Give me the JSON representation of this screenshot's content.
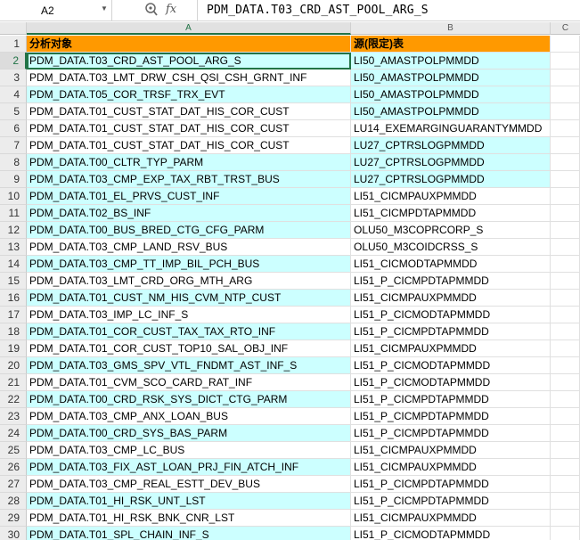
{
  "formula_bar": {
    "name_box": "A2",
    "fx_label": "fx",
    "content": "PDM_DATA.T03_CRD_AST_POOL_ARG_S"
  },
  "columns": [
    "A",
    "B",
    "C"
  ],
  "header_row": {
    "row": "1",
    "a": "分析对象",
    "b": "源(限定)表"
  },
  "rows": [
    {
      "n": "2",
      "a": "PDM_DATA.T03_CRD_AST_POOL_ARG_S",
      "b": "LI50_AMASTPOLPMMDD",
      "hl_a": true,
      "hl_b": true
    },
    {
      "n": "3",
      "a": "PDM_DATA.T03_LMT_DRW_CSH_QSI_CSH_GRNT_INF",
      "b": "LI50_AMASTPOLPMMDD",
      "hl_a": false,
      "hl_b": true
    },
    {
      "n": "4",
      "a": "PDM_DATA.T05_COR_TRSF_TRX_EVT",
      "b": "LI50_AMASTPOLPMMDD",
      "hl_a": true,
      "hl_b": true
    },
    {
      "n": "5",
      "a": "PDM_DATA.T01_CUST_STAT_DAT_HIS_COR_CUST",
      "b": "LI50_AMASTPOLPMMDD",
      "hl_a": false,
      "hl_b": true
    },
    {
      "n": "6",
      "a": "PDM_DATA.T01_CUST_STAT_DAT_HIS_COR_CUST",
      "b": "LU14_EXEMARGINGUARANTYMMDD",
      "hl_a": false,
      "hl_b": false
    },
    {
      "n": "7",
      "a": "PDM_DATA.T01_CUST_STAT_DAT_HIS_COR_CUST",
      "b": "LU27_CPTRSLOGPMMDD",
      "hl_a": false,
      "hl_b": true
    },
    {
      "n": "8",
      "a": "PDM_DATA.T00_CLTR_TYP_PARM",
      "b": "LU27_CPTRSLOGPMMDD",
      "hl_a": true,
      "hl_b": true
    },
    {
      "n": "9",
      "a": "PDM_DATA.T03_CMP_EXP_TAX_RBT_TRST_BUS",
      "b": "LU27_CPTRSLOGPMMDD",
      "hl_a": true,
      "hl_b": true
    },
    {
      "n": "10",
      "a": "PDM_DATA.T01_EL_PRVS_CUST_INF",
      "b": "LI51_CICMPAUXPMMDD",
      "hl_a": true,
      "hl_b": false
    },
    {
      "n": "11",
      "a": "PDM_DATA.T02_BS_INF",
      "b": "LI51_CICMPDTAPMMDD",
      "hl_a": true,
      "hl_b": false
    },
    {
      "n": "12",
      "a": "PDM_DATA.T00_BUS_BRED_CTG_CFG_PARM",
      "b": "OLU50_M3COPRCORP_S",
      "hl_a": true,
      "hl_b": false
    },
    {
      "n": "13",
      "a": "PDM_DATA.T03_CMP_LAND_RSV_BUS",
      "b": "OLU50_M3COIDCRSS_S",
      "hl_a": false,
      "hl_b": false
    },
    {
      "n": "14",
      "a": "PDM_DATA.T03_CMP_TT_IMP_BIL_PCH_BUS",
      "b": "LI51_CICMODTAPMMDD",
      "hl_a": true,
      "hl_b": false
    },
    {
      "n": "15",
      "a": "PDM_DATA.T03_LMT_CRD_ORG_MTH_ARG",
      "b": "LI51_P_CICMPDTAPMMDD",
      "hl_a": false,
      "hl_b": false
    },
    {
      "n": "16",
      "a": "PDM_DATA.T01_CUST_NM_HIS_CVM_NTP_CUST",
      "b": "LI51_CICMPAUXPMMDD",
      "hl_a": true,
      "hl_b": false
    },
    {
      "n": "17",
      "a": "PDM_DATA.T03_IMP_LC_INF_S",
      "b": "LI51_P_CICMODTAPMMDD",
      "hl_a": false,
      "hl_b": false
    },
    {
      "n": "18",
      "a": "PDM_DATA.T01_COR_CUST_TAX_TAX_RTO_INF",
      "b": "LI51_P_CICMPDTAPMMDD",
      "hl_a": true,
      "hl_b": false
    },
    {
      "n": "19",
      "a": "PDM_DATA.T01_COR_CUST_TOP10_SAL_OBJ_INF",
      "b": "LI51_CICMPAUXPMMDD",
      "hl_a": false,
      "hl_b": false
    },
    {
      "n": "20",
      "a": "PDM_DATA.T03_GMS_SPV_VTL_FNDMT_AST_INF_S",
      "b": "LI51_P_CICMODTAPMMDD",
      "hl_a": true,
      "hl_b": false
    },
    {
      "n": "21",
      "a": "PDM_DATA.T01_CVM_SCO_CARD_RAT_INF",
      "b": "LI51_P_CICMODTAPMMDD",
      "hl_a": false,
      "hl_b": false
    },
    {
      "n": "22",
      "a": "PDM_DATA.T00_CRD_RSK_SYS_DICT_CTG_PARM",
      "b": "LI51_P_CICMPDTAPMMDD",
      "hl_a": true,
      "hl_b": false
    },
    {
      "n": "23",
      "a": "PDM_DATA.T03_CMP_ANX_LOAN_BUS",
      "b": "LI51_P_CICMPDTAPMMDD",
      "hl_a": false,
      "hl_b": false
    },
    {
      "n": "24",
      "a": "PDM_DATA.T00_CRD_SYS_BAS_PARM",
      "b": "LI51_P_CICMPDTAPMMDD",
      "hl_a": true,
      "hl_b": false
    },
    {
      "n": "25",
      "a": "PDM_DATA.T03_CMP_LC_BUS",
      "b": "LI51_CICMPAUXPMMDD",
      "hl_a": false,
      "hl_b": false
    },
    {
      "n": "26",
      "a": "PDM_DATA.T03_FIX_AST_LOAN_PRJ_FIN_ATCH_INF",
      "b": "LI51_CICMPAUXPMMDD",
      "hl_a": true,
      "hl_b": false
    },
    {
      "n": "27",
      "a": "PDM_DATA.T03_CMP_REAL_ESTT_DEV_BUS",
      "b": "LI51_P_CICMPDTAPMMDD",
      "hl_a": false,
      "hl_b": false
    },
    {
      "n": "28",
      "a": "PDM_DATA.T01_HI_RSK_UNT_LST",
      "b": "LI51_P_CICMPDTAPMMDD",
      "hl_a": true,
      "hl_b": false
    },
    {
      "n": "29",
      "a": "PDM_DATA.T01_HI_RSK_BNK_CNR_LST",
      "b": "LI51_CICMPAUXPMMDD",
      "hl_a": false,
      "hl_b": false
    },
    {
      "n": "30",
      "a": "PDM_DATA.T01_SPL_CHAIN_INF_S",
      "b": "LI51_P_CICMODTAPMMDD",
      "hl_a": true,
      "hl_b": false
    }
  ],
  "colors": {
    "header_fill": "#ff9900",
    "highlight_fill": "#ccffff",
    "selection_green": "#217346"
  }
}
